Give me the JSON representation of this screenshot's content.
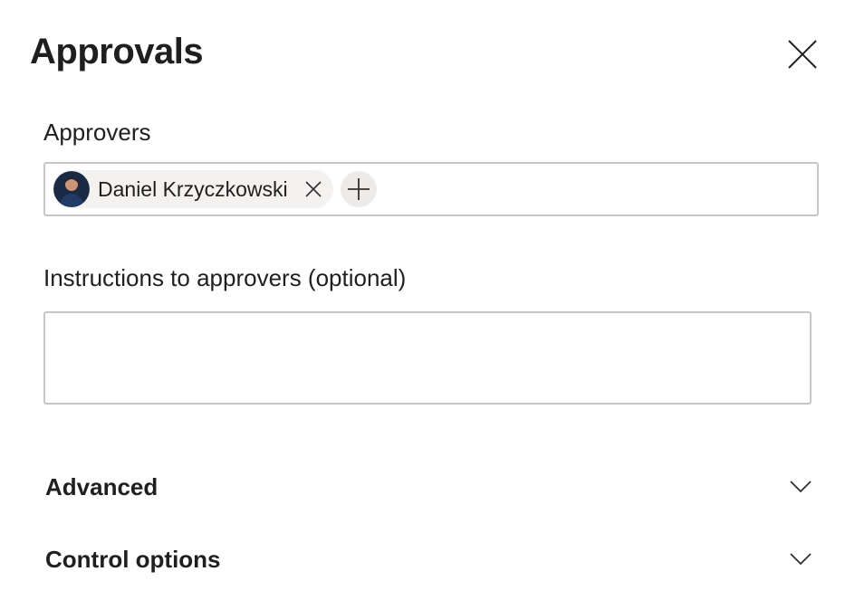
{
  "panel": {
    "title": "Approvals"
  },
  "approvers": {
    "label": "Approvers",
    "selected": [
      {
        "name": "Daniel Krzyczkowski"
      }
    ]
  },
  "instructions": {
    "label": "Instructions to approvers (optional)",
    "value": "",
    "placeholder": ""
  },
  "sections": {
    "advanced": {
      "label": "Advanced"
    },
    "control_options": {
      "label": "Control options"
    }
  },
  "colors": {
    "border": "#c8c6c4",
    "chip_bg": "#f3f2f1",
    "text": "#201f1e"
  }
}
